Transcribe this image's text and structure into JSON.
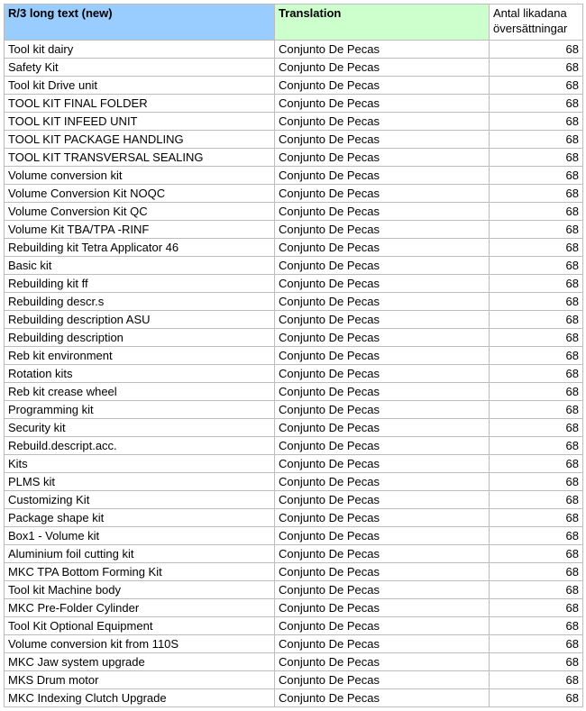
{
  "headers": {
    "col_a": "R/3 long text (new)",
    "col_b": "Translation",
    "col_c": "Antal likadana översättningar"
  },
  "rows": [
    {
      "a": "Tool kit dairy",
      "b": "Conjunto De Pecas",
      "c": 68
    },
    {
      "a": "Safety Kit",
      "b": "Conjunto De Pecas",
      "c": 68
    },
    {
      "a": "Tool kit Drive unit",
      "b": "Conjunto De Pecas",
      "c": 68
    },
    {
      "a": "TOOL KIT FINAL FOLDER",
      "b": "Conjunto De Pecas",
      "c": 68
    },
    {
      "a": "TOOL KIT INFEED UNIT",
      "b": "Conjunto De Pecas",
      "c": 68
    },
    {
      "a": "TOOL KIT PACKAGE HANDLING",
      "b": "Conjunto De Pecas",
      "c": 68
    },
    {
      "a": "TOOL KIT TRANSVERSAL SEALING",
      "b": "Conjunto De Pecas",
      "c": 68
    },
    {
      "a": "Volume conversion kit",
      "b": "Conjunto De Pecas",
      "c": 68
    },
    {
      "a": "Volume Conversion Kit NOQC",
      "b": "Conjunto De Pecas",
      "c": 68
    },
    {
      "a": "Volume Conversion Kit QC",
      "b": "Conjunto De Pecas",
      "c": 68
    },
    {
      "a": "Volume Kit TBA/TPA -RINF",
      "b": "Conjunto De Pecas",
      "c": 68
    },
    {
      "a": "Rebuilding kit Tetra Applicator 46",
      "b": "Conjunto De Pecas",
      "c": 68
    },
    {
      "a": "Basic kit",
      "b": "Conjunto De Pecas",
      "c": 68
    },
    {
      "a": "Rebuilding kit ff",
      "b": "Conjunto De Pecas",
      "c": 68
    },
    {
      "a": "Rebuilding descr.s",
      "b": "Conjunto De Pecas",
      "c": 68
    },
    {
      "a": "Rebuilding description ASU",
      "b": "Conjunto De Pecas",
      "c": 68
    },
    {
      "a": "Rebuilding description",
      "b": "Conjunto De Pecas",
      "c": 68
    },
    {
      "a": "Reb kit environment",
      "b": "Conjunto De Pecas",
      "c": 68
    },
    {
      "a": "Rotation kits",
      "b": "Conjunto De Pecas",
      "c": 68
    },
    {
      "a": "Reb kit crease wheel",
      "b": "Conjunto De Pecas",
      "c": 68
    },
    {
      "a": "Programming kit",
      "b": "Conjunto De Pecas",
      "c": 68
    },
    {
      "a": "Security kit",
      "b": "Conjunto De Pecas",
      "c": 68
    },
    {
      "a": "Rebuild.descript.acc.",
      "b": "Conjunto De Pecas",
      "c": 68
    },
    {
      "a": "Kits",
      "b": "Conjunto De Pecas",
      "c": 68
    },
    {
      "a": "PLMS kit",
      "b": "Conjunto De Pecas",
      "c": 68
    },
    {
      "a": "Customizing Kit",
      "b": "Conjunto De Pecas",
      "c": 68
    },
    {
      "a": "Package shape kit",
      "b": "Conjunto De Pecas",
      "c": 68
    },
    {
      "a": "Box1 - Volume kit",
      "b": "Conjunto De Pecas",
      "c": 68
    },
    {
      "a": "Aluminium foil cutting kit",
      "b": "Conjunto De Pecas",
      "c": 68
    },
    {
      "a": "MKC TPA Bottom Forming Kit",
      "b": "Conjunto De Pecas",
      "c": 68
    },
    {
      "a": "Tool kit Machine body",
      "b": "Conjunto De Pecas",
      "c": 68
    },
    {
      "a": "MKC Pre-Folder Cylinder",
      "b": "Conjunto De Pecas",
      "c": 68
    },
    {
      "a": "Tool Kit Optional Equipment",
      "b": "Conjunto De Pecas",
      "c": 68
    },
    {
      "a": "Volume conversion kit from 110S",
      "b": "Conjunto De Pecas",
      "c": 68
    },
    {
      "a": "MKC Jaw system upgrade",
      "b": "Conjunto De Pecas",
      "c": 68
    },
    {
      "a": "MKS Drum motor",
      "b": "Conjunto De Pecas",
      "c": 68
    },
    {
      "a": "MKC Indexing Clutch Upgrade",
      "b": "Conjunto De Pecas",
      "c": 68
    }
  ]
}
